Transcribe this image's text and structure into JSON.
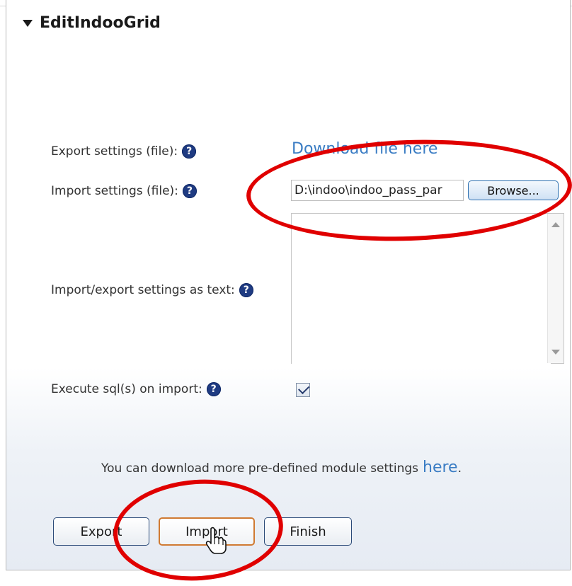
{
  "section": {
    "title": "EditIndooGrid"
  },
  "form": {
    "export_label": "Export settings (file):",
    "download_link": "Download file here",
    "import_label": "Import settings (file):",
    "file_value": "D:\\indoo\\indoo_pass_par",
    "browse_label": "Browse...",
    "text_label": "Import/export settings as text:",
    "text_value": "",
    "execute_label": "Execute sql(s) on import:",
    "execute_checked": true,
    "help_glyph": "?"
  },
  "footer": {
    "more_text": "You can download more pre-defined module settings",
    "here_link": "here",
    "period": "."
  },
  "buttons": {
    "export": "Export",
    "import": "Import",
    "finish": "Finish"
  },
  "colors": {
    "link": "#3b7dc4",
    "annotation": "#e00000",
    "help_icon": "#1f3b82"
  },
  "icons": {
    "help": "question-circle-icon",
    "collapse": "triangle-down-icon",
    "cursor": "hand-pointer-icon",
    "check": "checkmark-icon"
  }
}
